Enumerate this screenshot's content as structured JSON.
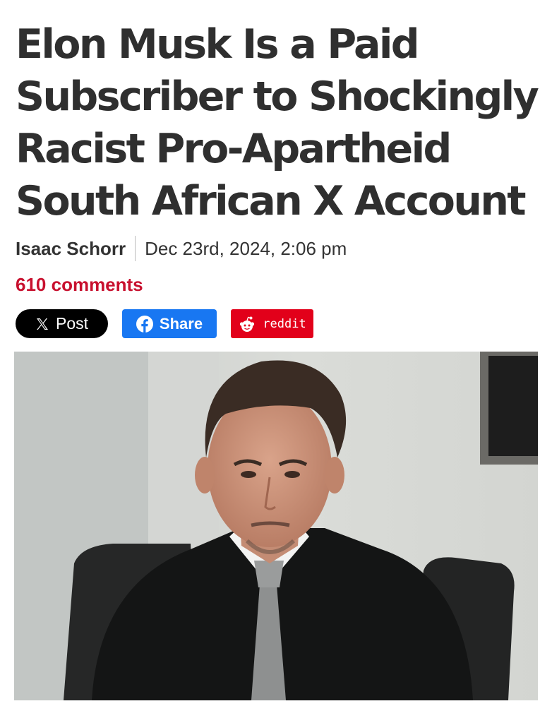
{
  "article": {
    "headline": "Elon Musk Is a Paid Subscriber to Shockingly Racist Pro-Apartheid South African X Account",
    "author": "Isaac Schorr",
    "date": "Dec 23rd, 2024, 2:06 pm",
    "comments": "610 comments"
  },
  "share": {
    "x_label": "Post",
    "facebook_label": "Share",
    "reddit_label": "reddit",
    "x_icon": "x-logo-icon",
    "facebook_icon": "facebook-logo-icon",
    "reddit_icon": "reddit-alien-icon"
  },
  "colors": {
    "comments": "#c8102e",
    "x_button": "#000000",
    "facebook_button": "#1877f2",
    "reddit_button": "#e2001a"
  }
}
